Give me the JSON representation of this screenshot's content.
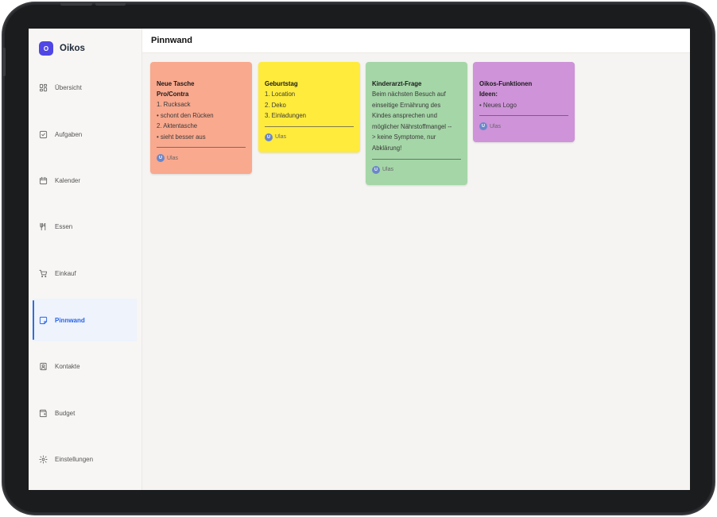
{
  "app": {
    "name": "Oikos",
    "logo_letter": "O"
  },
  "sidebar": {
    "items": [
      {
        "label": "Übersicht",
        "icon": "dashboard-icon"
      },
      {
        "label": "Aufgaben",
        "icon": "checkbox-icon"
      },
      {
        "label": "Kalender",
        "icon": "calendar-icon"
      },
      {
        "label": "Essen",
        "icon": "utensils-icon"
      },
      {
        "label": "Einkauf",
        "icon": "cart-icon"
      },
      {
        "label": "Pinnwand",
        "icon": "sticky-note-icon",
        "active": true
      },
      {
        "label": "Kontakte",
        "icon": "contact-book-icon"
      },
      {
        "label": "Budget",
        "icon": "wallet-icon"
      },
      {
        "label": "Einstellungen",
        "icon": "gear-icon"
      }
    ]
  },
  "header": {
    "title": "Pinnwand"
  },
  "notes": [
    {
      "color": "#f9a98e",
      "title_lines": [
        "Neue Tasche",
        "Pro/Contra"
      ],
      "lines": [
        "1.  Rucksack",
        "•  schont den Rücken",
        "2. Aktentasche",
        "• sieht besser aus"
      ],
      "author_initial": "U",
      "author": "Ulas"
    },
    {
      "color": "#ffeb3b",
      "title_lines": [
        "Geburtstag"
      ],
      "lines": [
        "1. Location",
        "2. Deko",
        "3. Einladungen"
      ],
      "author_initial": "U",
      "author": "Ulas"
    },
    {
      "color": "#a5d6a7",
      "title_lines": [
        "Kinderarzt-Frage"
      ],
      "lines": [
        "Beim nächsten Besuch auf",
        "einseitige Ernährung des",
        "Kindes ansprechen und",
        "möglicher Nährstoffmangel --",
        "> keine Symptome, nur",
        "Abklärung!"
      ],
      "author_initial": "U",
      "author": "Ulas"
    },
    {
      "color": "#ce93d8",
      "title_lines": [
        "Oikos-Funktionen"
      ],
      "lines_bold": [
        "Ideen:"
      ],
      "lines": [
        "• Neues Logo"
      ],
      "author_initial": "U",
      "author": "Ulas"
    }
  ],
  "fab": {
    "icon": "plus-icon"
  }
}
